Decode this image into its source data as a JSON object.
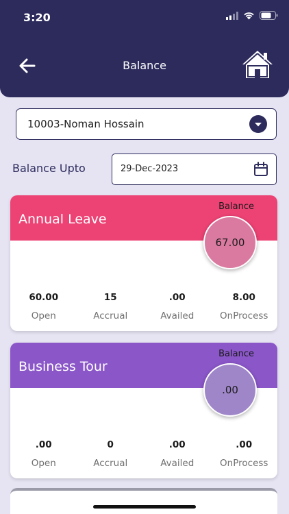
{
  "status_bar": {
    "time": "3:20"
  },
  "header": {
    "title": "Balance",
    "back_icon": "arrow-left-icon",
    "home_icon": "home-icon"
  },
  "employee_select": {
    "value": "10003-Noman Hossain",
    "icon": "chevron-down-icon"
  },
  "balance_upto": {
    "label": "Balance Upto",
    "date": "29-Dec-2023",
    "icon": "calendar-icon"
  },
  "colors": {
    "header": "#2c2b5c",
    "annual_leave": "#ec4274",
    "annual_circle": "#db7aa0",
    "business_tour": "#8a56c8",
    "business_circle": "#9f86c9"
  },
  "cards": [
    {
      "title": "Annual Leave",
      "balance_label": "Balance",
      "balance": "67.00",
      "stats": [
        {
          "value": "60.00",
          "label": "Open"
        },
        {
          "value": "15",
          "label": "Accrual"
        },
        {
          "value": ".00",
          "label": "Availed"
        },
        {
          "value": "8.00",
          "label": "OnProcess"
        }
      ]
    },
    {
      "title": "Business Tour",
      "balance_label": "Balance",
      "balance": ".00",
      "stats": [
        {
          "value": ".00",
          "label": "Open"
        },
        {
          "value": "0",
          "label": "Accrual"
        },
        {
          "value": ".00",
          "label": "Availed"
        },
        {
          "value": ".00",
          "label": "OnProcess"
        }
      ]
    }
  ]
}
